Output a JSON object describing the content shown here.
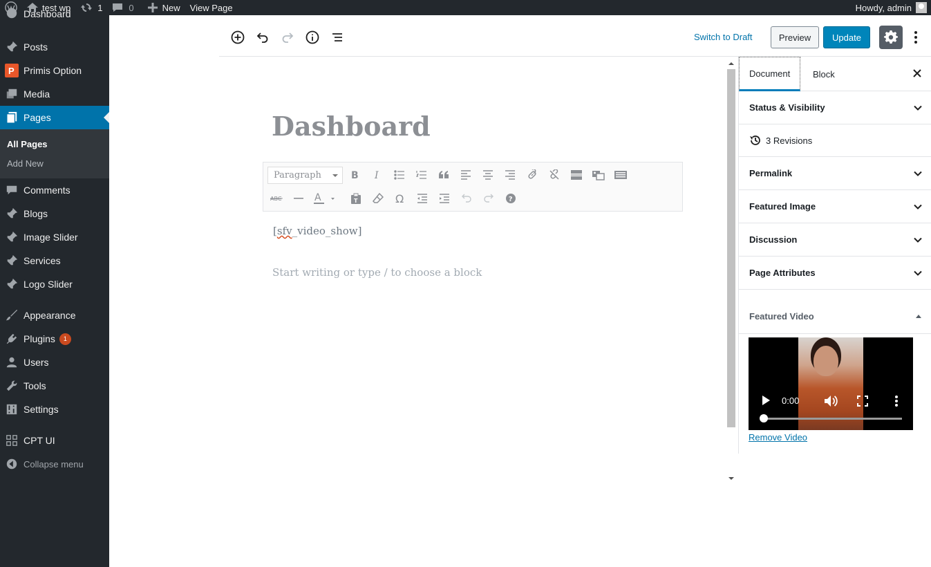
{
  "admin_bar": {
    "site_name": "test wp",
    "updates_count": "1",
    "comments_count": "0",
    "new_label": "New",
    "view_page_label": "View Page",
    "howdy": "Howdy, admin"
  },
  "sidebar": {
    "partial_top_label": "Dashboard",
    "items": [
      {
        "label": "Posts",
        "icon": "pin-icon"
      },
      {
        "label": "Primis Option",
        "icon": "primis-logo-icon"
      },
      {
        "label": "Media",
        "icon": "media-icon"
      },
      {
        "label": "Pages",
        "icon": "pages-icon"
      },
      {
        "label": "Comments",
        "icon": "comments-icon"
      },
      {
        "label": "Blogs",
        "icon": "pin-icon"
      },
      {
        "label": "Image Slider",
        "icon": "pin-icon"
      },
      {
        "label": "Services",
        "icon": "pin-icon"
      },
      {
        "label": "Logo Slider",
        "icon": "pin-icon"
      },
      {
        "label": "Appearance",
        "icon": "brush-icon"
      },
      {
        "label": "Plugins",
        "icon": "plug-icon"
      },
      {
        "label": "Users",
        "icon": "users-icon"
      },
      {
        "label": "Tools",
        "icon": "wrench-icon"
      },
      {
        "label": "Settings",
        "icon": "sliders-icon"
      },
      {
        "label": "CPT UI",
        "icon": "grid-icon"
      }
    ],
    "submenu": [
      "All Pages",
      "Add New"
    ],
    "plugins_badge": "1",
    "collapse_label": "Collapse menu",
    "current_item": "Pages",
    "accent_color": "#0073aa"
  },
  "editor_header": {
    "switch_to_draft": "Switch to Draft",
    "preview": "Preview",
    "update": "Update"
  },
  "canvas": {
    "title": "Dashboard",
    "format_select": "Paragraph",
    "shortcode_prefix": "[",
    "shortcode_misspelled": "sfv",
    "shortcode_suffix": "_video_show]",
    "placeholder": "Start writing or type / to choose a block"
  },
  "settings_sidebar": {
    "tabs": [
      "Document",
      "Block"
    ],
    "active_tab": "Document",
    "panels": [
      "Status & Visibility",
      "Permalink",
      "Featured Image",
      "Discussion",
      "Page Attributes"
    ],
    "revisions": "3 Revisions",
    "featured_video_title": "Featured Video",
    "video_time": "0:00",
    "video_progress_fraction": 0,
    "remove_video": "Remove Video"
  }
}
